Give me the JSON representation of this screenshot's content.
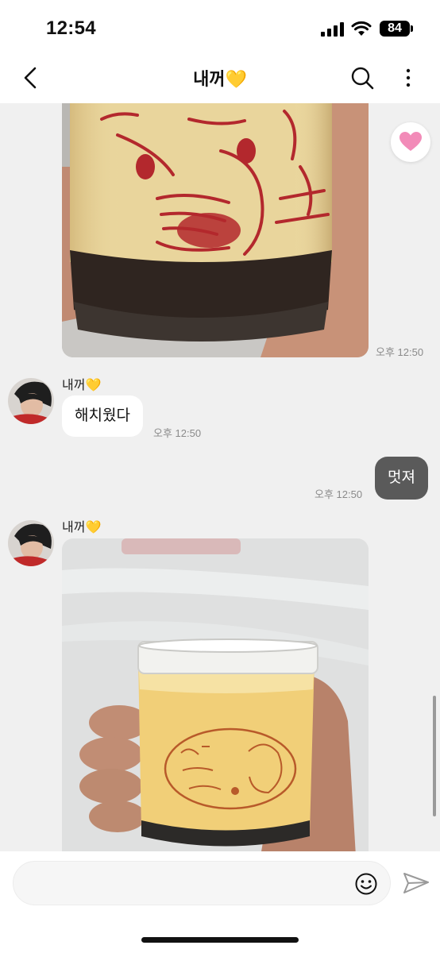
{
  "status_bar": {
    "time": "12:54",
    "battery": "84"
  },
  "header": {
    "title": "내꺼💛",
    "back_icon": "chevron-left-icon",
    "search_icon": "search-icon",
    "more_icon": "more-vertical-icon"
  },
  "messages": [
    {
      "type": "photo",
      "direction": "incoming",
      "description_icon": "pudding-jar-photo",
      "time": "오후 12:50"
    },
    {
      "type": "text",
      "direction": "incoming",
      "sender": "내꺼💛",
      "text": "해치웠다",
      "time": "오후 12:50"
    },
    {
      "type": "text",
      "direction": "outgoing",
      "text": "멋져",
      "time": "오후 12:50"
    },
    {
      "type": "photo",
      "direction": "incoming",
      "sender": "내꺼💛",
      "description_icon": "pudding-jar-photo"
    }
  ],
  "reaction": {
    "icon": "heart-icon",
    "color": "#f28bb8"
  },
  "input": {
    "placeholder": "",
    "value": ""
  },
  "colors": {
    "background": "#f0f0f0",
    "outgoing_bubble": "#5a5a5a",
    "incoming_bubble": "#ffffff"
  }
}
